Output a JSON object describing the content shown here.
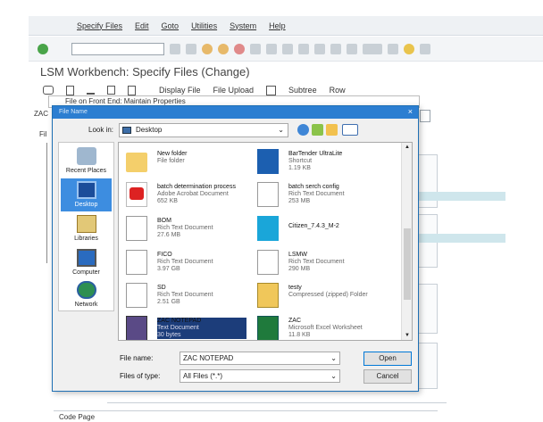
{
  "menubar": {
    "items": [
      "Specify Files",
      "Edit",
      "Goto",
      "Utilities",
      "System",
      "Help"
    ]
  },
  "window_title": "LSM Workbench: Specify Files (Change)",
  "app_toolbar": {
    "items": [
      "Display File",
      "File Upload",
      "Subtree",
      "Row"
    ]
  },
  "background": {
    "left_label_1": "ZAC",
    "left_label_2": "Fil",
    "code_page_label": "Code Page"
  },
  "prop_dialog": {
    "title": "File on Front End: Maintain Properties"
  },
  "file_dialog": {
    "title": "File Name",
    "look_in_label": "Look in:",
    "look_in_value": "Desktop",
    "places": [
      {
        "label": "Recent Places",
        "icon": "recent-places-icon"
      },
      {
        "label": "Desktop",
        "icon": "desktop-icon"
      },
      {
        "label": "Libraries",
        "icon": "libraries-icon"
      },
      {
        "label": "Computer",
        "icon": "computer-icon"
      },
      {
        "label": "Network",
        "icon": "network-icon"
      }
    ],
    "files": [
      {
        "name": "New folder",
        "type": "File folder",
        "size": "",
        "icon": "folder-icon"
      },
      {
        "name": "BarTender UltraLite",
        "type": "Shortcut",
        "size": "1.19 KB",
        "icon": "bartender-icon"
      },
      {
        "name": "batch determination process",
        "type": "Adobe Acrobat Document",
        "size": "652 KB",
        "icon": "pdf-icon"
      },
      {
        "name": "batch serch config",
        "type": "Rich Text Document",
        "size": "253 MB",
        "icon": "rtf-icon"
      },
      {
        "name": "BOM",
        "type": "Rich Text Document",
        "size": "27.6 MB",
        "icon": "rtf-icon"
      },
      {
        "name": "Citizen_7.4.3_M-2",
        "type": "",
        "size": "",
        "icon": "citizen-icon"
      },
      {
        "name": "FICO",
        "type": "Rich Text Document",
        "size": "3.97 GB",
        "icon": "rtf-icon"
      },
      {
        "name": "LSMW",
        "type": "Rich Text Document",
        "size": "290 MB",
        "icon": "rtf-icon"
      },
      {
        "name": "SD",
        "type": "Rich Text Document",
        "size": "2.51 GB",
        "icon": "rtf-icon"
      },
      {
        "name": "testy",
        "type": "Compressed (zipped) Folder",
        "size": "",
        "icon": "zip-icon"
      },
      {
        "name": "ZAC NOTEPAD",
        "type": "Text Document",
        "size": "30 bytes",
        "icon": "notepad-icon"
      },
      {
        "name": "ZAC",
        "type": "Microsoft Excel Worksheet",
        "size": "11.8 KB",
        "icon": "excel-icon"
      }
    ],
    "filename_label": "File name:",
    "filename_value": "ZAC NOTEPAD",
    "filetype_label": "Files of type:",
    "filetype_value": "All Files (*.*)",
    "open_label": "Open",
    "cancel_label": "Cancel"
  },
  "colors": {
    "accent": "#2c7ed1",
    "selection": "#1c3d7a",
    "sap_teal": "#cfe6ec"
  }
}
